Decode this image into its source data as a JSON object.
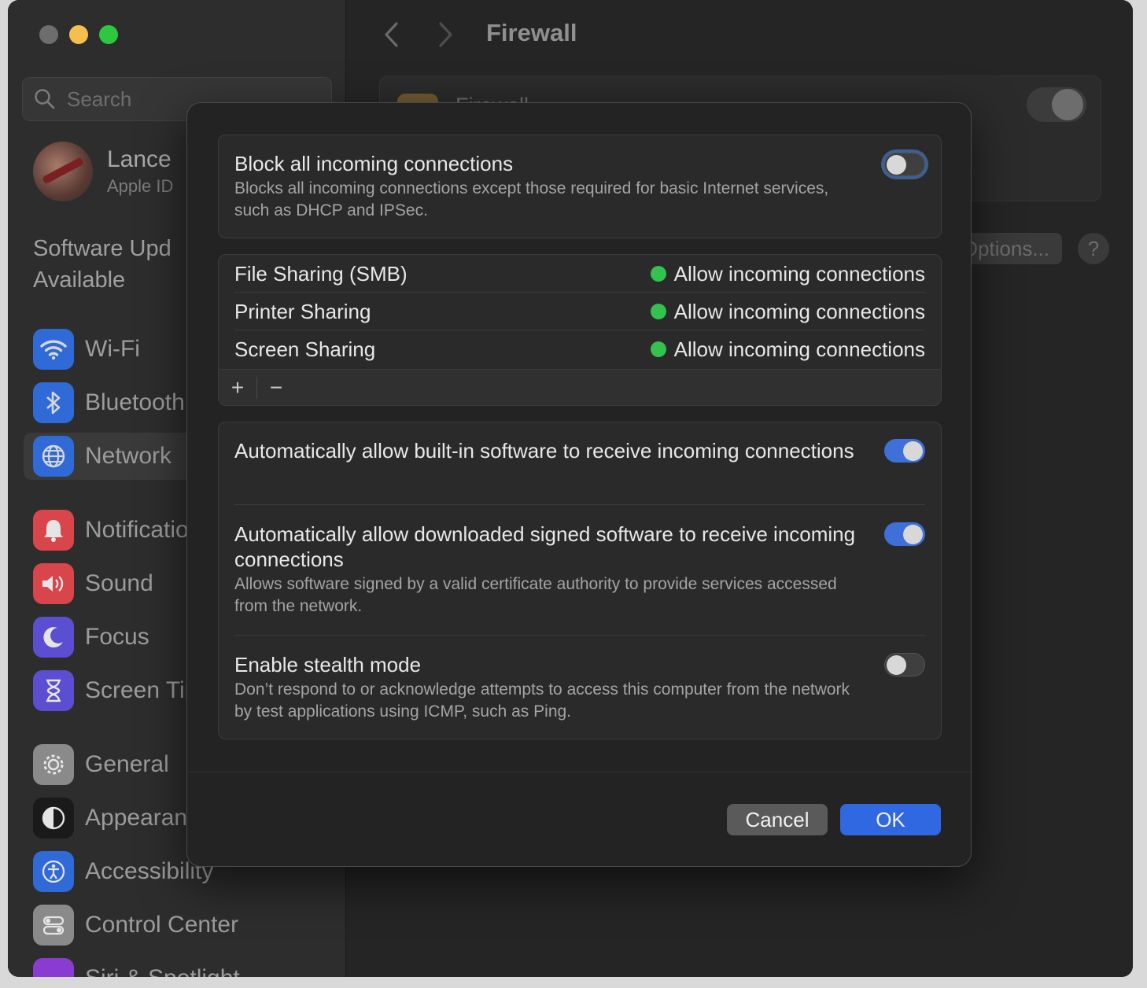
{
  "sidebar": {
    "search_placeholder": "Search",
    "profile": {
      "name": "Lance",
      "subtitle": "Apple ID"
    },
    "update_line1": "Software Upd",
    "update_line2": "Available",
    "items": [
      {
        "label": "Wi-Fi",
        "icon": "wifi-icon",
        "color": "#2f6ad6"
      },
      {
        "label": "Bluetooth",
        "icon": "bluetooth-icon",
        "color": "#2f6ad6"
      },
      {
        "label": "Network",
        "icon": "globe-icon",
        "color": "#2f6ad6"
      },
      {
        "label": "Notifications",
        "icon": "bell-icon",
        "color": "#d8454a"
      },
      {
        "label": "Sound",
        "icon": "speaker-icon",
        "color": "#d8454a"
      },
      {
        "label": "Focus",
        "icon": "moon-icon",
        "color": "#5b4ed0"
      },
      {
        "label": "Screen Time",
        "icon": "hourglass-icon",
        "color": "#5b4ed0"
      },
      {
        "label": "General",
        "icon": "gear-icon",
        "color": "#8a8a8a"
      },
      {
        "label": "Appearance",
        "icon": "appearance-icon",
        "color": "#1a1a1a"
      },
      {
        "label": "Accessibility",
        "icon": "accessibility-icon",
        "color": "#2f6ad6"
      },
      {
        "label": "Control Center",
        "icon": "control-center-icon",
        "color": "#8a8a8a"
      },
      {
        "label": "Siri & Spotlight",
        "icon": "siri-icon",
        "color": "#8a3bd0"
      }
    ]
  },
  "main": {
    "title": "Firewall",
    "card_title": "Firewall",
    "options_label": "Options...",
    "help_label": "?"
  },
  "dialog": {
    "block_all": {
      "title": "Block all incoming connections",
      "description": "Blocks all incoming connections except those required for basic Internet services, such as DHCP and IPSec.",
      "enabled": false
    },
    "services": [
      {
        "name": "File Sharing (SMB)",
        "status": "Allow incoming connections"
      },
      {
        "name": "Printer Sharing",
        "status": "Allow incoming connections"
      },
      {
        "name": "Screen Sharing",
        "status": "Allow incoming connections"
      }
    ],
    "toolbar": {
      "add": "+",
      "remove": "−"
    },
    "auto_builtin": {
      "title": "Automatically allow built-in software to receive incoming connections",
      "enabled": true
    },
    "auto_signed": {
      "title": "Automatically allow downloaded signed software to receive incoming connections",
      "description": "Allows software signed by a valid certificate authority to provide services accessed from the network.",
      "enabled": true
    },
    "stealth": {
      "title": "Enable stealth mode",
      "description": "Don’t respond to or acknowledge attempts to access this computer from the network by test applications using ICMP, such as Ping.",
      "enabled": false
    },
    "cancel_label": "Cancel",
    "ok_label": "OK"
  },
  "colors": {
    "accent": "#2f68e0",
    "status_green": "#32c24d"
  }
}
